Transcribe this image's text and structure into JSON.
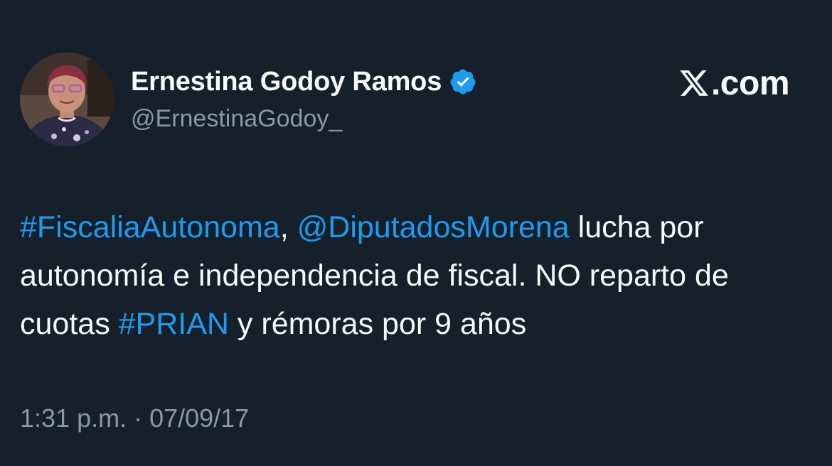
{
  "tweet": {
    "author": {
      "display_name": "Ernestina Godoy Ramos",
      "handle": "@ErnestinaGodoy_",
      "verified_icon": "verified-badge-icon",
      "avatar": "profile-photo"
    },
    "brand": {
      "icon": "x-logo-icon",
      "text": ".com"
    },
    "body": {
      "hashtag_1": "#FiscaliaAutonoma",
      "sep_1": ", ",
      "mention_1": "@DiputadosMorena",
      "text_1": " lucha por autonomía e independencia de fiscal. NO reparto de cuotas ",
      "hashtag_2": "#PRIAN",
      "text_2": " y rémoras por 9 años"
    },
    "timestamp": "1:31 p.m. · 07/09/17"
  },
  "colors": {
    "background": "#15202b",
    "text_primary": "#f7f9f9",
    "text_secondary": "#8b98a5",
    "link": "#1d9bf0"
  }
}
